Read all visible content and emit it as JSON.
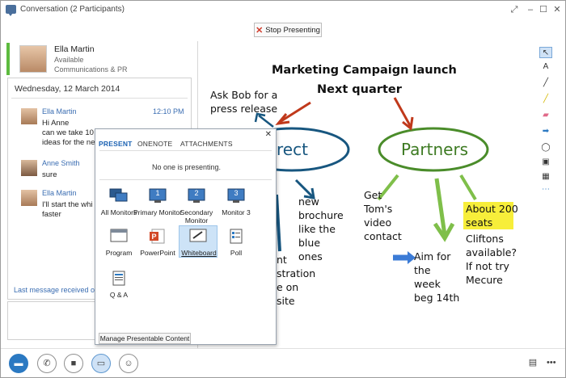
{
  "window": {
    "title": "Conversation (2 Participants)",
    "controls": [
      "snap-icon",
      "minimize-icon",
      "maximize-icon",
      "close-icon"
    ]
  },
  "stop_presenting": {
    "label": "Stop Presenting"
  },
  "contact": {
    "name": "Ella Martin",
    "status": "Available",
    "department": "Communications & PR"
  },
  "conversation": {
    "date": "Wednesday, 12 March 2014",
    "messages": [
      {
        "name": "Ella Martin",
        "time": "12:10 PM",
        "lines": [
          "Hi Anne",
          "can we take 10",
          "ideas for the ne"
        ]
      },
      {
        "name": "Anne Smith",
        "time": "",
        "lines": [
          "sure"
        ]
      },
      {
        "name": "Ella Martin",
        "time": "",
        "lines": [
          "I'll start the whi",
          "faster"
        ]
      }
    ],
    "last_message": "Last message received on"
  },
  "whiteboard": {
    "title_line1": "Marketing Campaign launch",
    "title_line2": "Next quarter",
    "bubble_left": "rect",
    "bubble_right": "Partners",
    "note_ask": [
      "Ask Bob for a",
      "press release"
    ],
    "note_brochure": [
      "new",
      "brochure",
      "like the",
      "blue",
      "ones"
    ],
    "note_partial": [
      "nt",
      "stration",
      "e on",
      "site"
    ],
    "note_video": [
      "Get",
      "Tom's",
      "video",
      "contact"
    ],
    "note_aim": [
      "Aim for",
      "the",
      "week",
      "beg 14th"
    ],
    "note_about": [
      "About 200",
      "seats"
    ],
    "note_cliftons": [
      "Cliftons",
      "available?",
      "If not try",
      "Mecure"
    ],
    "highlight_color": "#f7ee3a"
  },
  "present_popup": {
    "tabs": [
      "PRESENT",
      "ONENOTE",
      "ATTACHMENTS"
    ],
    "status": "No one is presenting.",
    "options": [
      {
        "label": "All Monitors"
      },
      {
        "label": "Primary Monitor",
        "number": "1"
      },
      {
        "label": "Secondary Monitor",
        "number": "2"
      },
      {
        "label": "Monitor 3",
        "number": "3"
      },
      {
        "label": "Program"
      },
      {
        "label": "PowerPoint"
      },
      {
        "label": "Whiteboard"
      },
      {
        "label": "Poll"
      },
      {
        "label": "Q & A"
      }
    ],
    "manage_label": "Manage Presentable Content"
  },
  "bottom": {
    "buttons": [
      "im-icon",
      "phone-icon",
      "video-icon",
      "present-icon",
      "participants-icon"
    ],
    "more_label": "•••"
  }
}
